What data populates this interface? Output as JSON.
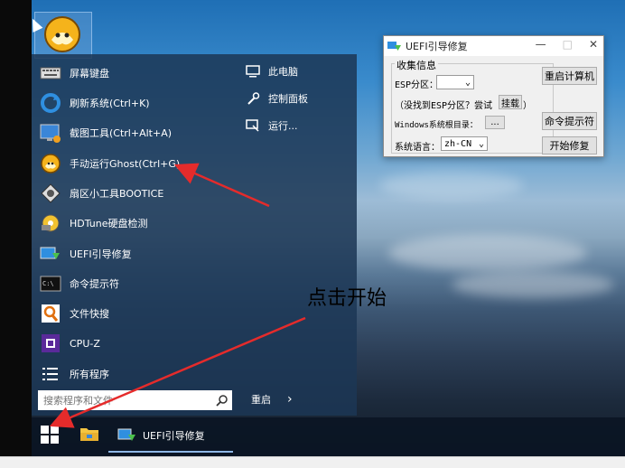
{
  "start_menu": {
    "items": [
      {
        "label": "屏幕键盘",
        "icon": "keyboard-icon"
      },
      {
        "label": "刷新系统(Ctrl+K)",
        "icon": "refresh-icon"
      },
      {
        "label": "截图工具(Ctrl+Alt+A)",
        "icon": "screenshot-icon"
      },
      {
        "label": "手动运行Ghost(Ctrl+G)",
        "icon": "ghost-icon"
      },
      {
        "label": "扇区小工具BOOTICE",
        "icon": "bootice-icon"
      },
      {
        "label": "HDTune硬盘检测",
        "icon": "hdtune-icon"
      },
      {
        "label": "UEFI引导修复",
        "icon": "uefi-repair-icon"
      },
      {
        "label": "命令提示符",
        "icon": "cmd-icon"
      },
      {
        "label": "文件快搜",
        "icon": "file-search-icon"
      },
      {
        "label": "CPU-Z",
        "icon": "cpuz-icon"
      },
      {
        "label": "所有程序",
        "icon": "list-icon"
      }
    ],
    "right_items": [
      {
        "label": "此电脑",
        "icon": "computer-icon"
      },
      {
        "label": "控制面板",
        "icon": "wrench-icon"
      },
      {
        "label": "运行...",
        "icon": "run-icon"
      }
    ],
    "search_placeholder": "搜索程序和文件",
    "restart_label": "重启",
    "restart_chevron": "›"
  },
  "taskbar": {
    "task_label": "UEFI引导修复"
  },
  "window": {
    "title": "UEFI引导修复",
    "minimize": "—",
    "maximize": "□",
    "close": "✕",
    "group_label": "收集信息",
    "esp_label": "ESP分区：",
    "esp_value": "",
    "hint_prefix": "（没找到ESP分区？尝试",
    "mount_button": "挂载",
    "hint_suffix": "）",
    "windows_dir_label": "Windows系统根目录：",
    "browse_button": "...",
    "language_label": "系统语言：",
    "language_value": "zh-CN",
    "restart_button": "重启计算机",
    "cmd_button": "命令提示符",
    "repair_button": "开始修复"
  },
  "annotation": {
    "text": "点击开始"
  },
  "colors": {
    "arrow": "#e52b2b",
    "menu_bg": "#1c3755",
    "accent": "#8fb7e6"
  }
}
